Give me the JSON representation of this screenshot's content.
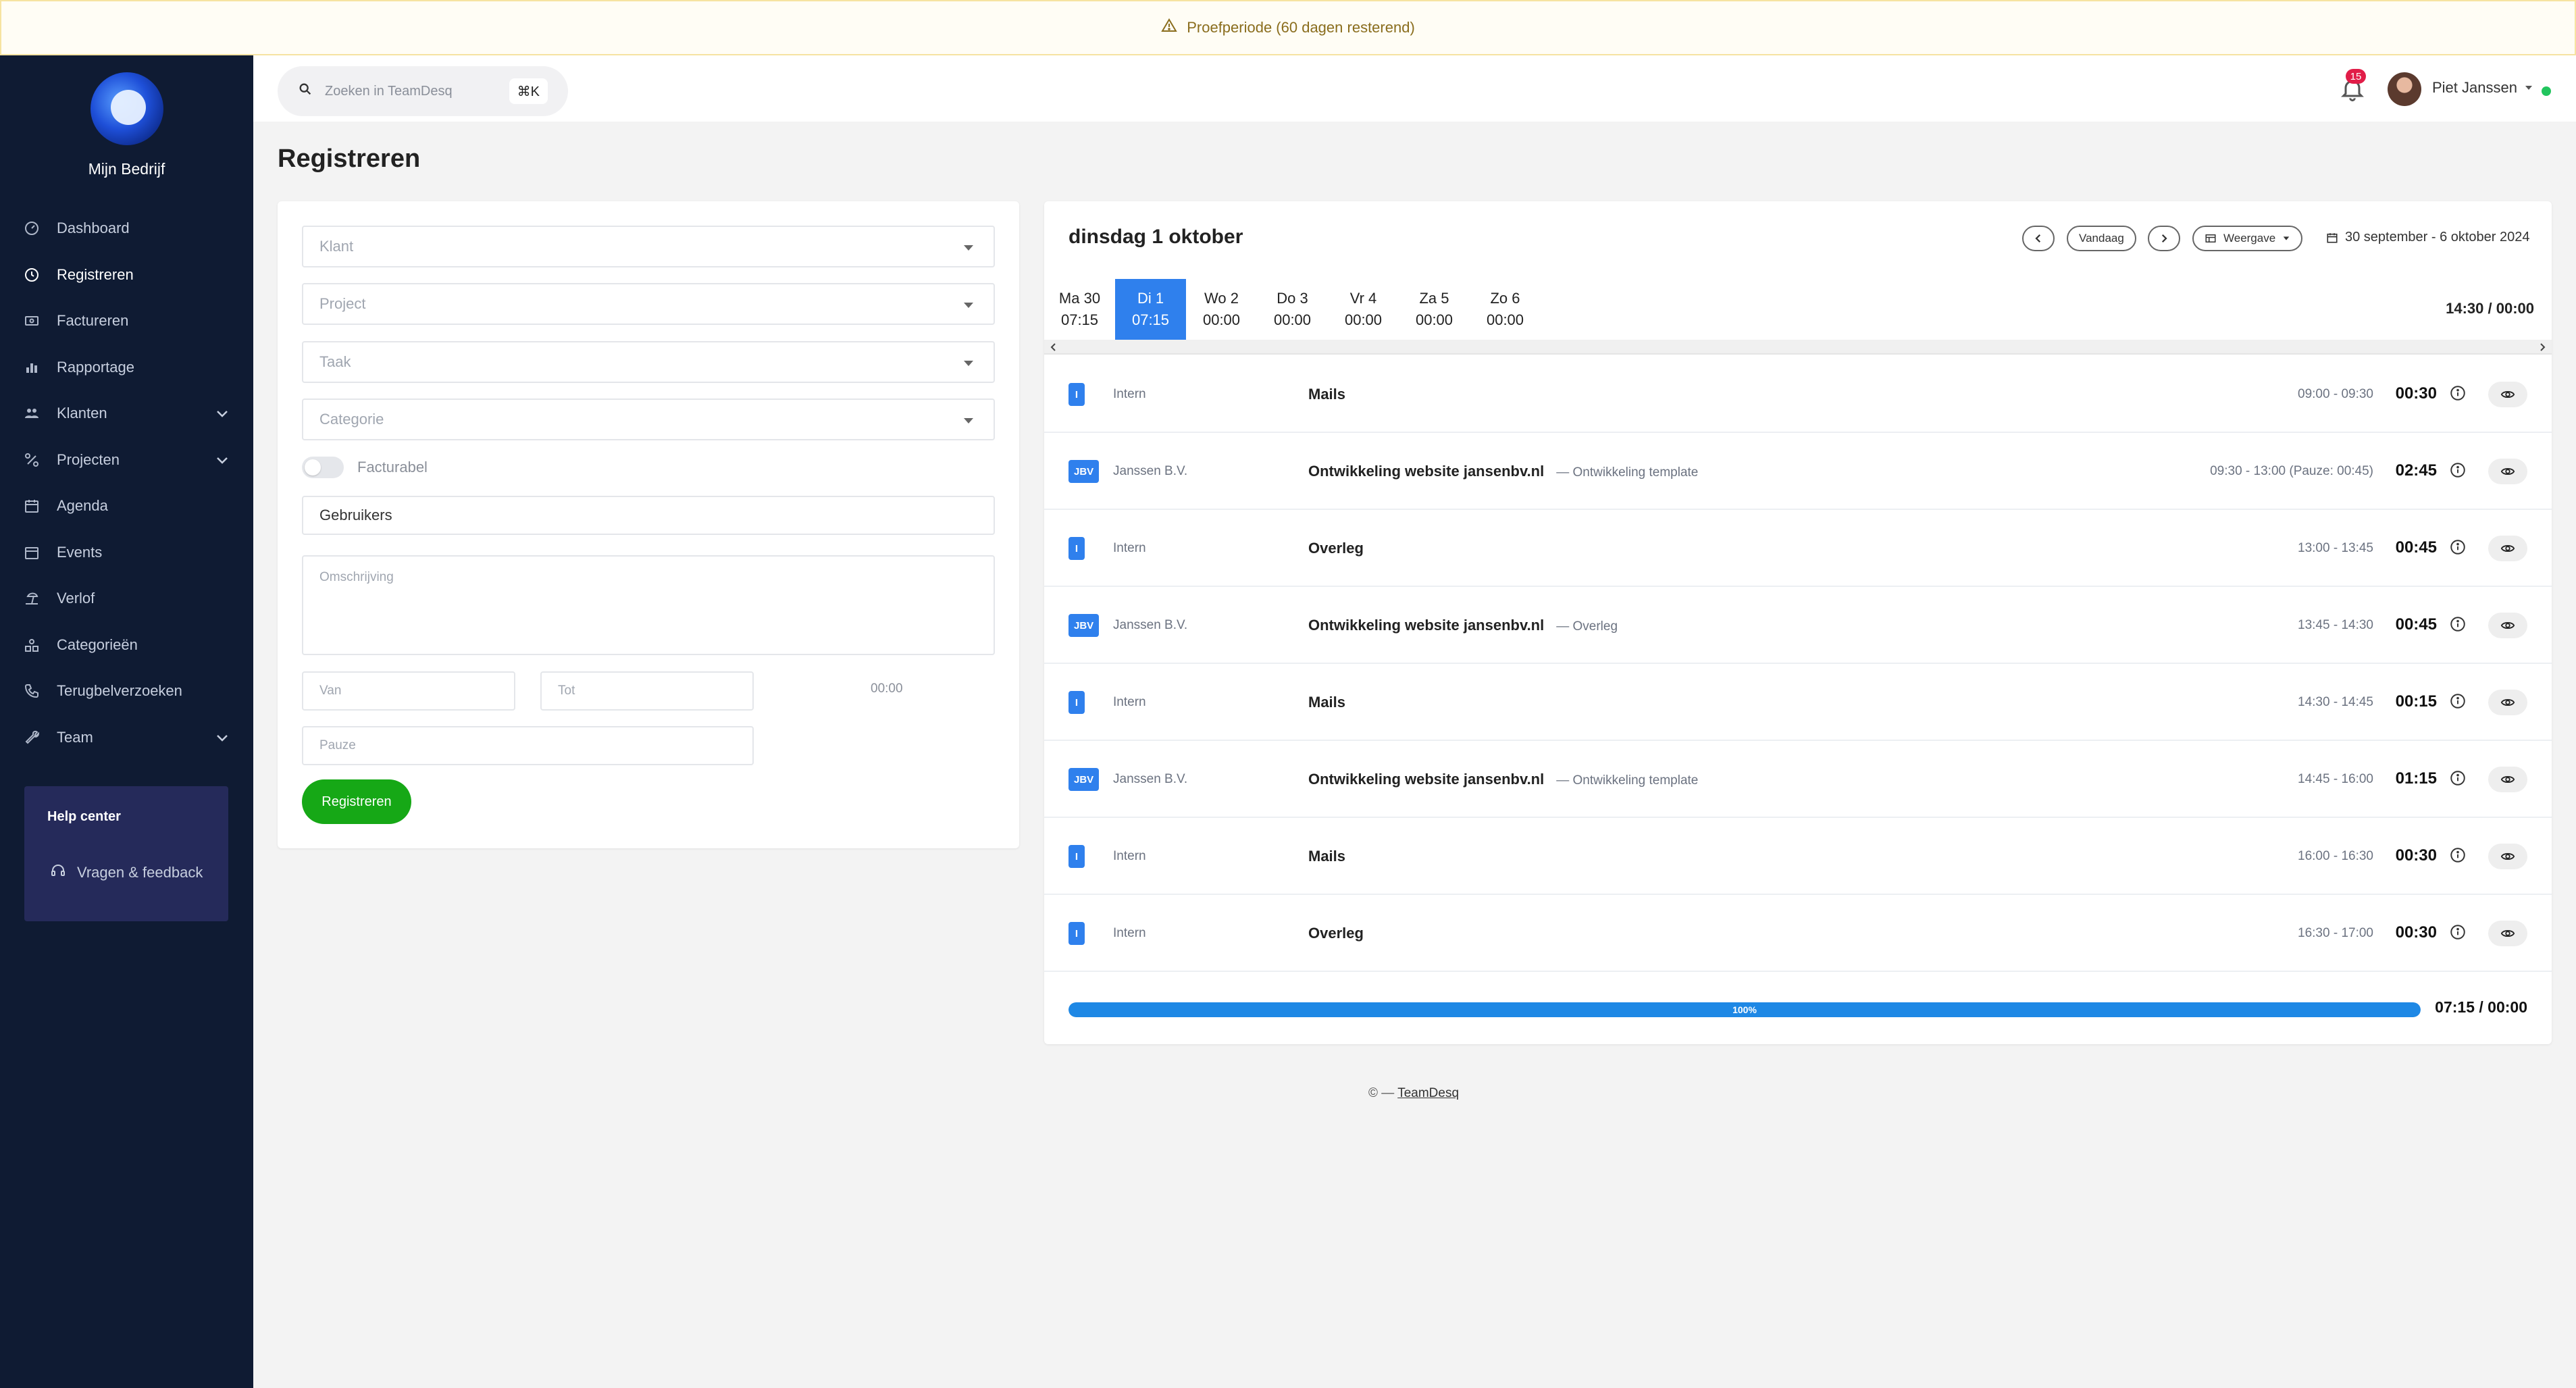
{
  "banner": {
    "text": "Proefperiode (60 dagen resterend)"
  },
  "sidebar": {
    "company": "Mijn Bedrijf",
    "items": [
      {
        "label": "Dashboard",
        "icon": "gauge-icon",
        "active": false
      },
      {
        "label": "Registreren",
        "icon": "clock-icon",
        "active": true
      },
      {
        "label": "Factureren",
        "icon": "money-icon",
        "active": false
      },
      {
        "label": "Rapportage",
        "icon": "bar-chart-icon",
        "active": false
      },
      {
        "label": "Klanten",
        "icon": "users-icon",
        "active": false,
        "expandable": true
      },
      {
        "label": "Projecten",
        "icon": "project-icon",
        "active": false,
        "expandable": true
      },
      {
        "label": "Agenda",
        "icon": "calendar-icon",
        "active": false
      },
      {
        "label": "Events",
        "icon": "calendar-event-icon",
        "active": false
      },
      {
        "label": "Verlof",
        "icon": "beach-icon",
        "active": false
      },
      {
        "label": "Categorieën",
        "icon": "shapes-icon",
        "active": false
      },
      {
        "label": "Terugbelverzoeken",
        "icon": "phone-icon",
        "active": false
      },
      {
        "label": "Team",
        "icon": "wrench-icon",
        "active": false,
        "expandable": true
      }
    ],
    "help": {
      "title": "Help center",
      "link": "Vragen & feedback"
    }
  },
  "topbar": {
    "search_placeholder": "Zoeken in TeamDesq",
    "shortcut": "⌘K",
    "notifications": "15",
    "user_name": "Piet Janssen"
  },
  "page": {
    "title": "Registreren"
  },
  "form": {
    "klant": "Klant",
    "project": "Project",
    "taak": "Taak",
    "categorie": "Categorie",
    "facturabel": "Facturabel",
    "gebruikers": "Gebruikers",
    "omschrijving": "Omschrijving",
    "van": "Van",
    "tot": "Tot",
    "duration": "00:00",
    "pauze": "Pauze",
    "submit": "Registreren"
  },
  "calendar": {
    "title": "dinsdag 1 oktober",
    "today_label": "Vandaag",
    "view_label": "Weergave",
    "date_range": "30 september - 6 oktober 2024",
    "week_total": "14:30 / 00:00",
    "days": [
      {
        "label": "Ma 30",
        "time": "07:15",
        "active": false
      },
      {
        "label": "Di 1",
        "time": "07:15",
        "active": true
      },
      {
        "label": "Wo 2",
        "time": "00:00",
        "active": false
      },
      {
        "label": "Do 3",
        "time": "00:00",
        "active": false
      },
      {
        "label": "Vr 4",
        "time": "00:00",
        "active": false
      },
      {
        "label": "Za 5",
        "time": "00:00",
        "active": false
      },
      {
        "label": "Zo 6",
        "time": "00:00",
        "active": false
      }
    ],
    "entries": [
      {
        "badge": "I",
        "client": "Intern",
        "project": "Mails",
        "task": "",
        "times": "09:00 - 09:30",
        "duration": "00:30"
      },
      {
        "badge": "JBV",
        "client": "Janssen B.V.",
        "project": "Ontwikkeling website jansenbv.nl",
        "task": "— Ontwikkeling template",
        "times": "09:30 - 13:00 (Pauze: 00:45)",
        "duration": "02:45"
      },
      {
        "badge": "I",
        "client": "Intern",
        "project": "Overleg",
        "task": "",
        "times": "13:00 - 13:45",
        "duration": "00:45"
      },
      {
        "badge": "JBV",
        "client": "Janssen B.V.",
        "project": "Ontwikkeling website jansenbv.nl",
        "task": "— Overleg",
        "times": "13:45 - 14:30",
        "duration": "00:45"
      },
      {
        "badge": "I",
        "client": "Intern",
        "project": "Mails",
        "task": "",
        "times": "14:30 - 14:45",
        "duration": "00:15"
      },
      {
        "badge": "JBV",
        "client": "Janssen B.V.",
        "project": "Ontwikkeling website jansenbv.nl",
        "task": "— Ontwikkeling template",
        "times": "14:45 - 16:00",
        "duration": "01:15"
      },
      {
        "badge": "I",
        "client": "Intern",
        "project": "Mails",
        "task": "",
        "times": "16:00 - 16:30",
        "duration": "00:30"
      },
      {
        "badge": "I",
        "client": "Intern",
        "project": "Overleg",
        "task": "",
        "times": "16:30 - 17:00",
        "duration": "00:30"
      }
    ],
    "progress": {
      "percent": 100,
      "label": "100%",
      "total": "07:15 / 00:00"
    }
  },
  "footer": {
    "prefix": "© —",
    "link": "TeamDesq"
  },
  "colors": {
    "accent": "#2f80ed",
    "sidebar": "#0f1b33",
    "success": "#16a816",
    "progress": "#1e88e5"
  }
}
